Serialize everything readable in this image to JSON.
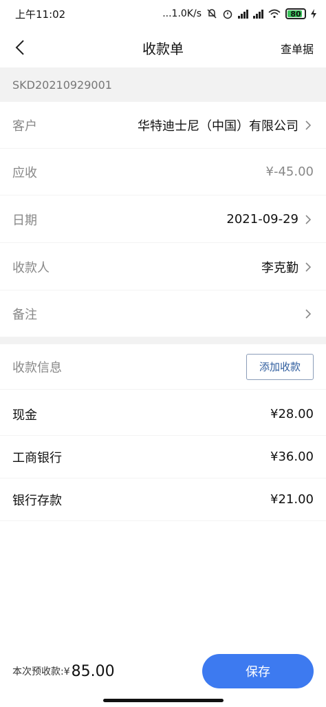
{
  "status_bar": {
    "time": "上午11:02",
    "network_speed": "...1.0K/s",
    "battery_level": "80",
    "battery_color": "#39c15a",
    "icons": [
      "mute-icon",
      "alarm-icon",
      "signal-icon",
      "signal-icon",
      "wifi-icon",
      "charging-icon"
    ]
  },
  "nav": {
    "back_icon": "chevron-left-icon",
    "title": "收款单",
    "action_label": "查单据"
  },
  "order_no": "SKD20210929001",
  "form": {
    "customer": {
      "label": "客户",
      "value": "华特迪士尼（中国）有限公司"
    },
    "receivable": {
      "label": "应收",
      "value": "¥-45.00"
    },
    "date": {
      "label": "日期",
      "value": "2021-09-29"
    },
    "payee": {
      "label": "收款人",
      "value": "李克勤"
    },
    "remark": {
      "label": "备注",
      "value": ""
    }
  },
  "payment_info": {
    "label": "收款信息",
    "add_button": "添加收款",
    "items": [
      {
        "name": "现金",
        "amount": "¥28.00"
      },
      {
        "name": "工商银行",
        "amount": "¥36.00"
      },
      {
        "name": "银行存款",
        "amount": "¥21.00"
      }
    ]
  },
  "footer": {
    "total_label": "本次预收款:¥",
    "total_value": "85.00",
    "save_label": "保存",
    "accent_color": "#3d7af0"
  }
}
